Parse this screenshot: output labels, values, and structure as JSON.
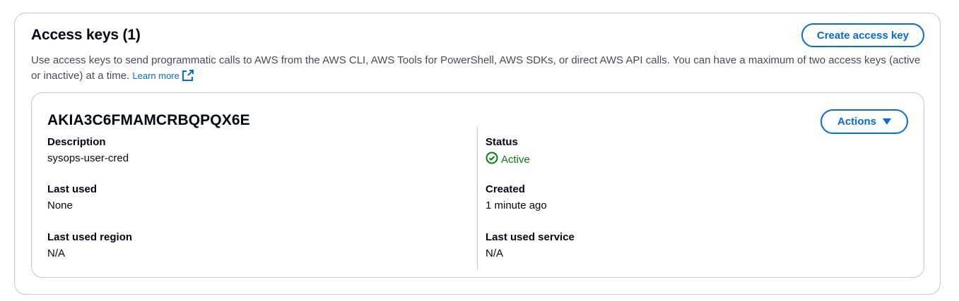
{
  "panel": {
    "title": "Access keys (1)",
    "description": "Use access keys to send programmatic calls to AWS from the AWS CLI, AWS Tools for PowerShell, AWS SDKs, or direct AWS API calls. You can have a maximum of two access keys (active or inactive) at a time.",
    "learn_more": "Learn more",
    "create_button": "Create access key"
  },
  "key": {
    "id": "AKIA3C6FMAMCRBQPQX6E",
    "actions_button": "Actions",
    "description_label": "Description",
    "description_value": "sysops-user-cred",
    "status_label": "Status",
    "status_value": "Active",
    "last_used_label": "Last used",
    "last_used_value": "None",
    "created_label": "Created",
    "created_value": "1 minute ago",
    "last_used_region_label": "Last used region",
    "last_used_region_value": "N/A",
    "last_used_service_label": "Last used service",
    "last_used_service_value": "N/A"
  },
  "icons": {
    "external_link": "external-link-icon",
    "status": "check-circle-icon",
    "dropdown": "caret-down-icon"
  },
  "colors": {
    "link": "#006ce0",
    "success": "#037f0c",
    "border": "#c6c6cd",
    "text": "#000716"
  }
}
